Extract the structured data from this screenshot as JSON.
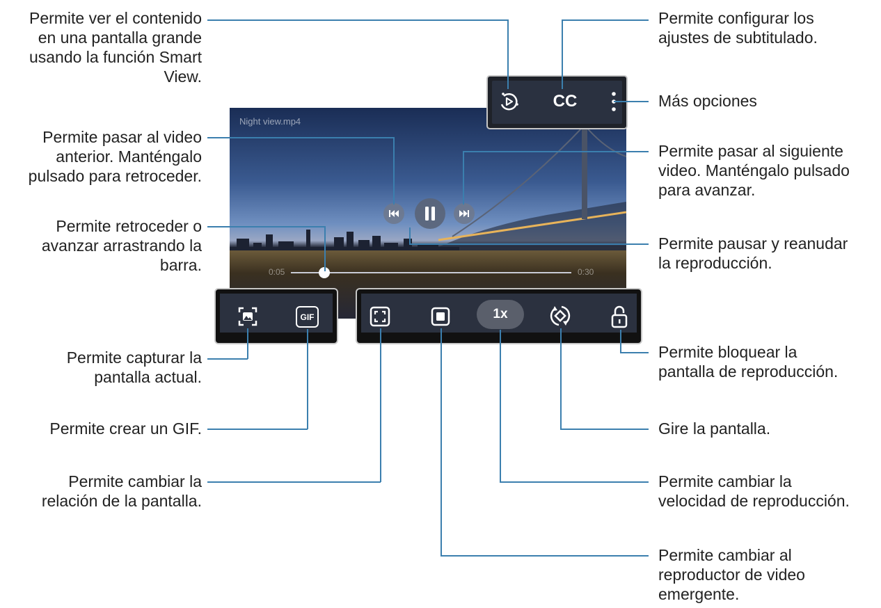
{
  "video": {
    "title": "Night view.mp4",
    "time_elapsed": "0:05",
    "time_total": "0:30",
    "progress": 0.12
  },
  "toolbar_top": {
    "cc_label": "CC"
  },
  "toolbar_bottom_left": {
    "gif_label": "GIF"
  },
  "toolbar_bottom_right": {
    "speed_label": "1x"
  },
  "labels": {
    "smart_view": "Permite ver el contenido\nen una pantalla grande\nusando la función Smart\nView.",
    "subtitles": "Permite configurar los\najustes de subtitulado.",
    "more_options": "Más opciones",
    "previous": "Permite pasar al video\nanterior. Manténgalo\npulsado para retroceder.",
    "next": "Permite pasar al siguiente\nvideo. Manténgalo pulsado\npara avanzar.",
    "seek": "Permite retroceder o\navanzar arrastrando la\nbarra.",
    "pause": "Permite pausar y reanudar\nla reproducción.",
    "capture": "Permite capturar la\npantalla actual.",
    "lock": "Permite bloquear la\npantalla de reproducción.",
    "gif": "Permite crear un GIF.",
    "rotate": "Gire la pantalla.",
    "ratio": "Permite cambiar la\nrelación de la pantalla.",
    "speed": "Permite cambiar la\nvelocidad de reproducción.",
    "popup": "Permite cambiar al\nreproductor de video\nemergente."
  },
  "colors": {
    "leader_line": "#3b7fae",
    "bar_border": "#c7c7c7"
  }
}
